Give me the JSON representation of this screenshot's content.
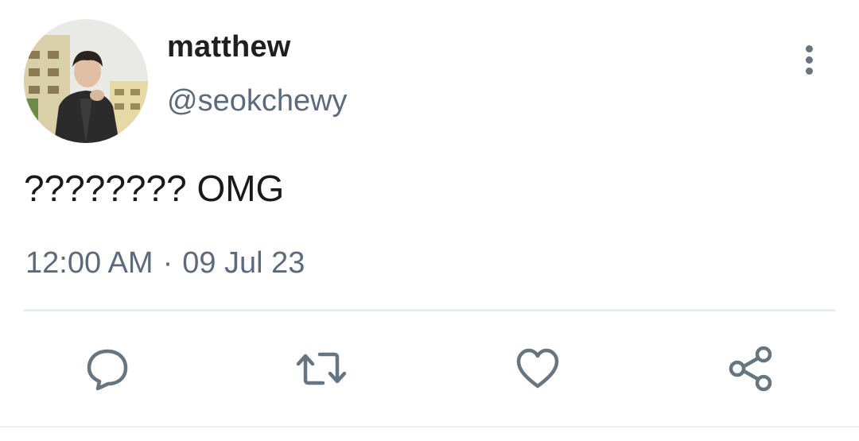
{
  "tweet": {
    "author": {
      "display_name": "matthew",
      "handle": "@seokchewy"
    },
    "text": "???????? OMG",
    "time": "12:00 AM",
    "separator": "·",
    "date": "09 Jul 23"
  },
  "actions": [
    {
      "name": "reply",
      "icon": "reply-bubble-icon"
    },
    {
      "name": "retweet",
      "icon": "retweet-icon"
    },
    {
      "name": "like",
      "icon": "heart-icon"
    },
    {
      "name": "share",
      "icon": "share-icon"
    }
  ],
  "colors": {
    "icon": "#66757f",
    "secondary_text": "#5b6b7c",
    "divider": "#e6ecf0"
  }
}
